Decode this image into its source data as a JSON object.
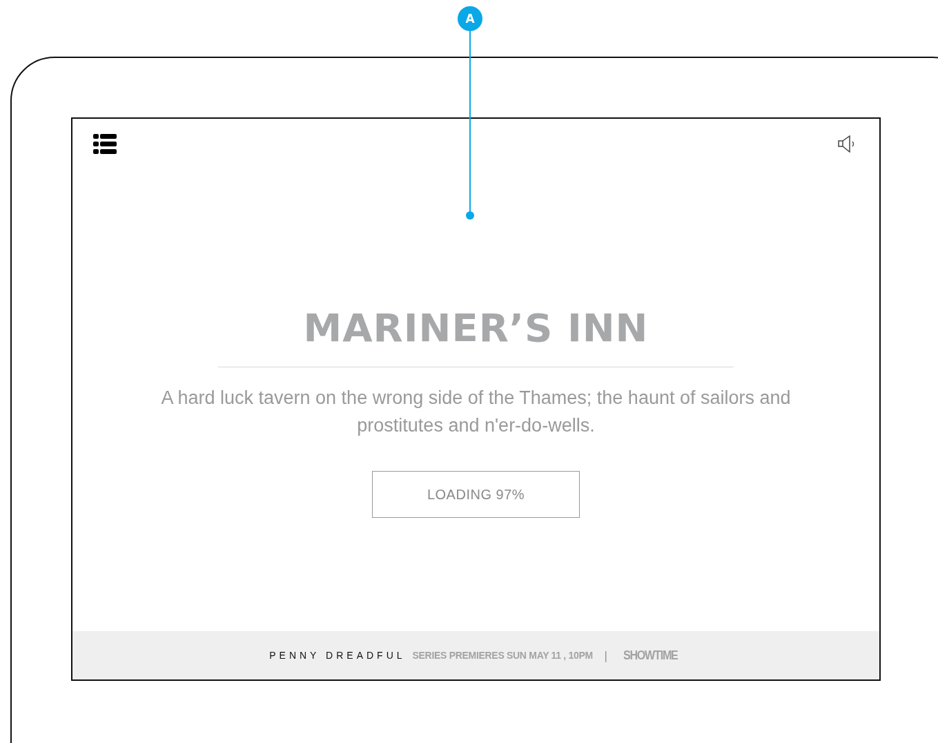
{
  "annotation": {
    "label": "A"
  },
  "title": "MARINER’S INN",
  "description": "A hard luck tavern on the wrong side of the Thames; the haunt of sailors and prostitutes and n'er-do-wells.",
  "loading_button": {
    "label": "LOADING 97%"
  },
  "footer": {
    "show": "PENNY DREADFUL",
    "premiere": "SERIES PREMIERES SUN MAY 11 , 10PM",
    "separator": "|",
    "network": "SHOWTIME"
  }
}
